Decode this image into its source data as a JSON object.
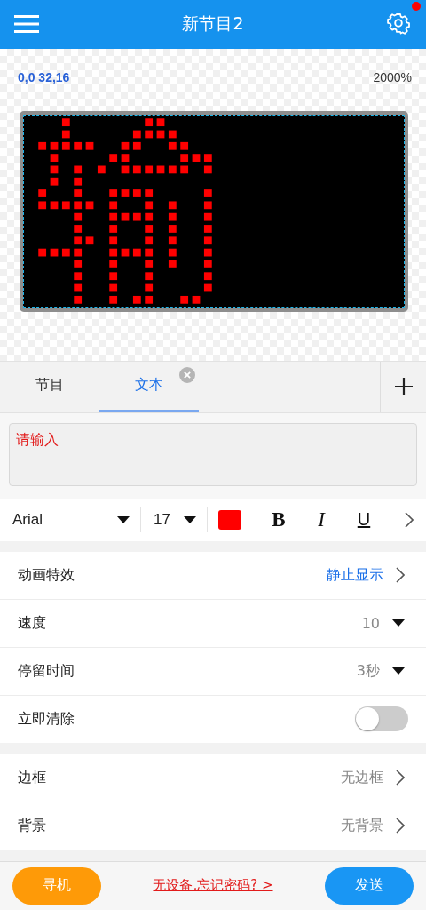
{
  "header": {
    "title": "新节目2",
    "notification": true
  },
  "canvas": {
    "coordinates": "0,0 32,16",
    "zoom": "2000%"
  },
  "tabs": [
    {
      "label": "节目",
      "selected": false,
      "closable": false
    },
    {
      "label": "文本",
      "selected": true,
      "closable": true
    }
  ],
  "text_input": {
    "placeholder": "请输入"
  },
  "format_bar": {
    "font": "Arial",
    "size": "17",
    "color": "#ff0000",
    "style_buttons": [
      {
        "label": "B",
        "kind": "bold"
      },
      {
        "label": "I",
        "kind": "italic"
      },
      {
        "label": "U",
        "kind": "underline"
      }
    ]
  },
  "settings_groups": [
    [
      {
        "label": "动画特效",
        "value": "静止显示",
        "kind": "link",
        "highlighted": true
      },
      {
        "label": "速度",
        "value": "10",
        "kind": "dropdown",
        "highlighted": false
      },
      {
        "label": "停留时间",
        "value": "3秒",
        "kind": "dropdown",
        "highlighted": false
      },
      {
        "label": "立即清除",
        "kind": "toggle",
        "on": false
      }
    ],
    [
      {
        "label": "边框",
        "value": "无边框",
        "kind": "link",
        "highlighted": false
      },
      {
        "label": "背景",
        "value": "无背景",
        "kind": "link",
        "highlighted": false
      }
    ]
  ],
  "footer": {
    "search_button": "寻机",
    "help_link": "无设备,忘记密码? >",
    "send_button": "发送"
  }
}
